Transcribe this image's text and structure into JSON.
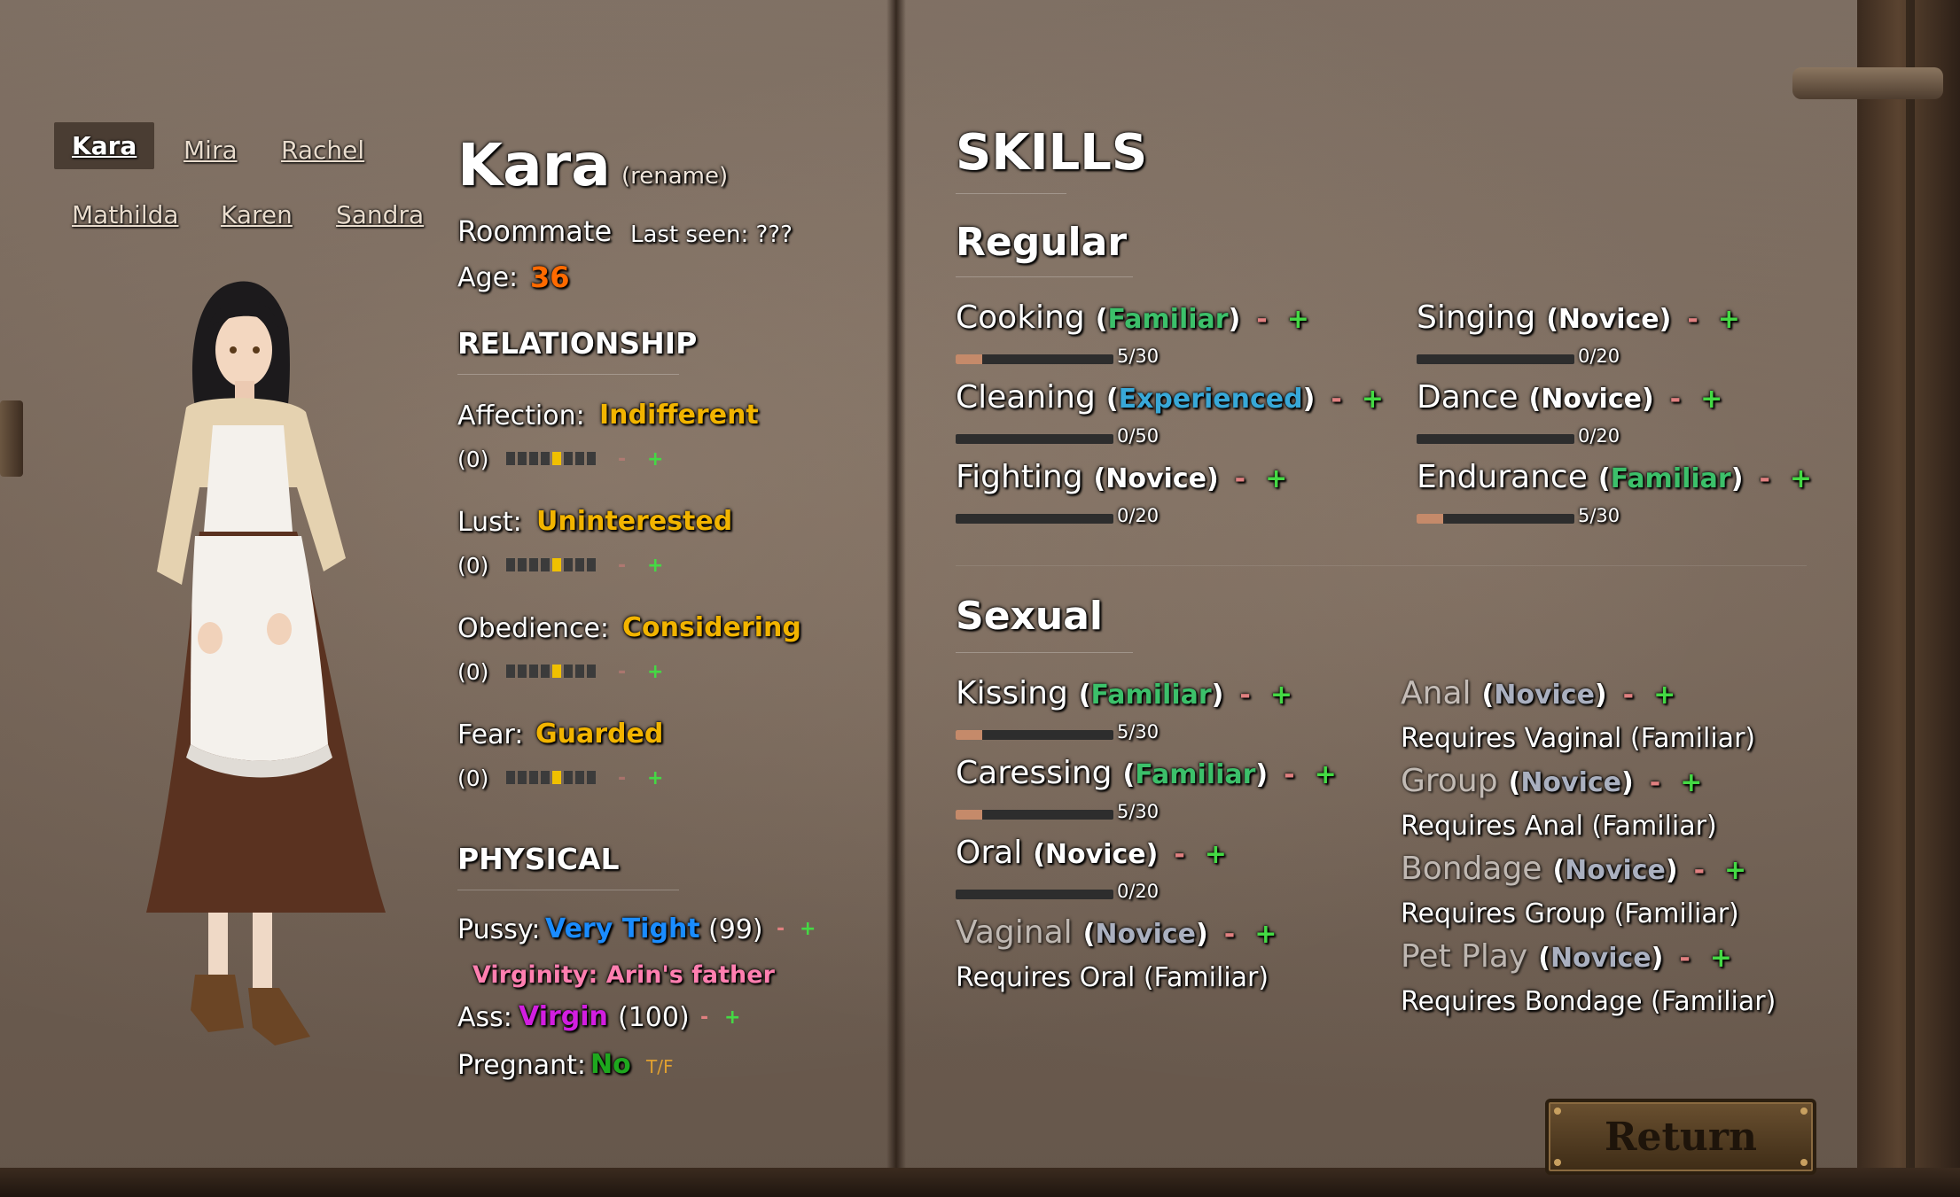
{
  "tabs": [
    "Kara",
    "Mira",
    "Rachel",
    "Mathilda",
    "Karen",
    "Sandra"
  ],
  "active_tab": "Kara",
  "profile": {
    "name": "Kara",
    "rename": "(rename)",
    "role": "Roommate",
    "last_seen": "Last seen: ???",
    "age_label": "Age:",
    "age_value": "36"
  },
  "relationship": {
    "title": "RELATIONSHIP",
    "items": [
      {
        "label": "Affection:",
        "value": "Indifferent",
        "num": "(0)",
        "level": 0.5
      },
      {
        "label": "Lust:",
        "value": "Uninterested",
        "num": "(0)",
        "level": 0.5
      },
      {
        "label": "Obedience:",
        "value": "Considering",
        "num": "(0)",
        "level": 0.5
      },
      {
        "label": "Fear:",
        "value": "Guarded",
        "num": "(0)",
        "level": 0.5
      }
    ],
    "minus": "-",
    "plus": "+"
  },
  "physical": {
    "title": "PHYSICAL",
    "pussy_label": "Pussy:",
    "pussy_value": "Very Tight",
    "pussy_num": "(99)",
    "virginity": "Virginity: Arin's father",
    "ass_label": "Ass:",
    "ass_value": "Virgin",
    "ass_num": "(100)",
    "pregnant_label": "Pregnant:",
    "pregnant_value": "No",
    "tf": "T/F",
    "minus": "-",
    "plus": "+"
  },
  "skills": {
    "title": "SKILLS",
    "regular_title": "Regular",
    "sexual_title": "Sexual",
    "regular": [
      {
        "name": "Cooking",
        "level": "Familiar",
        "progress": "5/30",
        "fraction": 0.167
      },
      {
        "name": "Cleaning",
        "level": "Experienced",
        "progress": "0/50",
        "fraction": 0
      },
      {
        "name": "Fighting",
        "level": "Novice",
        "progress": "0/20",
        "fraction": 0
      },
      {
        "name": "Singing",
        "level": "Novice",
        "progress": "0/20",
        "fraction": 0
      },
      {
        "name": "Dance",
        "level": "Novice",
        "progress": "0/20",
        "fraction": 0
      },
      {
        "name": "Endurance",
        "level": "Familiar",
        "progress": "5/30",
        "fraction": 0.167
      }
    ],
    "sexual": [
      {
        "name": "Kissing",
        "level": "Familiar",
        "progress": "5/30",
        "fraction": 0.167
      },
      {
        "name": "Caressing",
        "level": "Familiar",
        "progress": "5/30",
        "fraction": 0.167
      },
      {
        "name": "Oral",
        "level": "Novice",
        "progress": "0/20",
        "fraction": 0
      },
      {
        "name": "Vaginal",
        "level": "Novice",
        "requires": "Requires Oral (Familiar)"
      },
      {
        "name": "Anal",
        "level": "Novice",
        "requires": "Requires Vaginal (Familiar)"
      },
      {
        "name": "Group",
        "level": "Novice",
        "requires": "Requires Anal (Familiar)"
      },
      {
        "name": "Bondage",
        "level": "Novice",
        "requires": "Requires Group (Familiar)"
      },
      {
        "name": "Pet Play",
        "level": "Novice",
        "requires": "Requires Bondage (Familiar)"
      }
    ],
    "minus": "-",
    "plus": "+",
    "open_paren": "(",
    "close_paren": ")"
  },
  "return_label": "Return",
  "colors": {
    "age": "#ff6a00",
    "relationship_value": "#f2b400",
    "familiar": "#3cc06a",
    "experienced": "#38a8d8",
    "novice": "#ffffff",
    "very_tight": "#1a8cff",
    "virgin": "#d21ee0",
    "virginity": "#ff7fb0",
    "pregnant_no": "#1ea81e",
    "tf": "#e0a030"
  }
}
